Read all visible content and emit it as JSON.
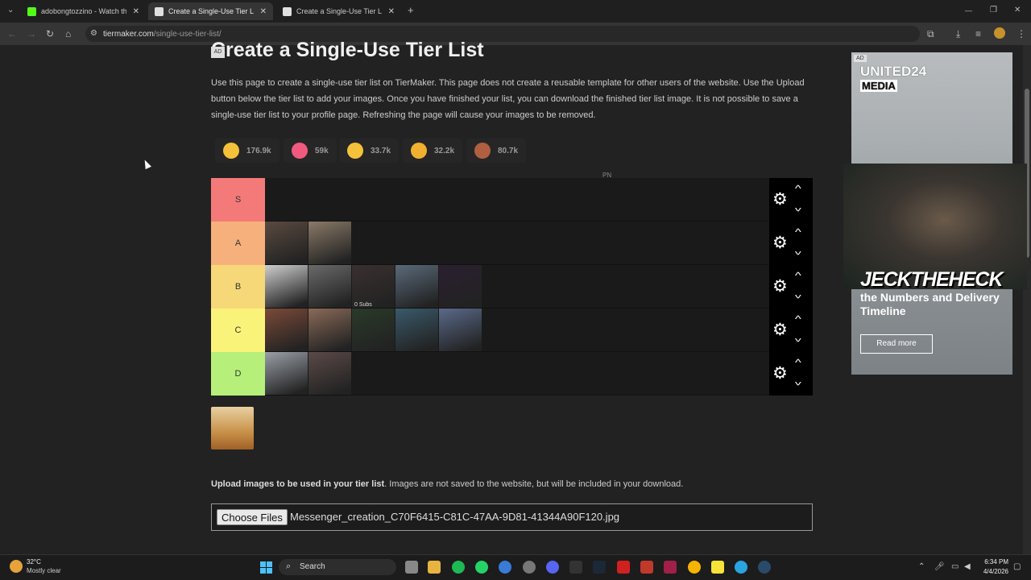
{
  "browser": {
    "tabs": [
      {
        "title": "adobongtozzino - Watch the V",
        "active": false,
        "favicon_color": "#53fc18"
      },
      {
        "title": "Create a Single-Use Tier List (P",
        "active": true,
        "favicon_color": "#e0e0e0"
      },
      {
        "title": "Create a Single-Use Tier List (P",
        "active": false,
        "favicon_color": "#e0e0e0"
      }
    ],
    "new_tab": "+",
    "url_domain": "tiermaker.com",
    "url_path": "/single-use-tier-list/",
    "window_controls": {
      "minimize": "—",
      "maximize": "❐",
      "close": "✕"
    }
  },
  "page": {
    "ad_badge": "AD",
    "title": "Create a Single-Use Tier List",
    "intro": "Use this page to create a single-use tier list on TierMaker. This page does not create a reusable template for other users of the website. Use the Upload button below the tier list to add your images. Once you have finished your list, you can download the finished tier list image. It is not possible to save a single-use tier list to your profile page. Refreshing the page will cause your images to be removed.",
    "reactions": [
      {
        "icon": "smile-emoji-icon",
        "count": "176.9k",
        "color": "#f5c13a"
      },
      {
        "icon": "heart-eyes-emoji-icon",
        "count": "59k",
        "color": "#f05a7e"
      },
      {
        "icon": "laughing-emoji-icon",
        "count": "33.7k",
        "color": "#f5c13a"
      },
      {
        "icon": "praise-hands-emoji-icon",
        "count": "32.2k",
        "color": "#f0b030"
      },
      {
        "icon": "poop-emoji-icon",
        "count": "80.7k",
        "color": "#b06040"
      }
    ],
    "pn_label": "PN",
    "tiers": [
      {
        "label": "S",
        "color": "#f47a7a",
        "items": []
      },
      {
        "label": "A",
        "color": "#f6b07c",
        "items": [
          "#5a4a40",
          "#8a7a68"
        ]
      },
      {
        "label": "B",
        "color": "#f7d878",
        "items": [
          "#cfcfcf",
          "#6a6a6a",
          "#3a3030",
          "#5a6a7a",
          "#2a2030"
        ]
      },
      {
        "label": "C",
        "color": "#faf37a",
        "items": [
          "#7a4a38",
          "#8a6a58",
          "#2a3a2a",
          "#3a5a6a",
          "#5a6a8a"
        ]
      },
      {
        "label": "D",
        "color": "#b6f07a",
        "items": [
          "#9aa0a8",
          "#5a4a48"
        ]
      }
    ],
    "b_overlay_text": "0 Subs",
    "upload_bold": "Upload images to be used in your tier list",
    "upload_rest": ". Images are not saved to the website, but will be included in your download.",
    "choose_files": "Choose Files",
    "file_name": "Messenger_creation_C70F6415-C81C-47AA-9D81-41344A90F120.jpg"
  },
  "ad": {
    "tag": "AD",
    "brand_line1": "UNITED24",
    "brand_line2": "MEDIA",
    "headline": "the Numbers and Delivery Timeline",
    "button": "Read more"
  },
  "stream_overlay": {
    "brand": "JECKTHEHECK"
  },
  "taskbar": {
    "temperature": "32°C",
    "weather": "Mostly clear",
    "search_label": "Search",
    "time": "6:34 PM",
    "date": "4/4/2026"
  }
}
